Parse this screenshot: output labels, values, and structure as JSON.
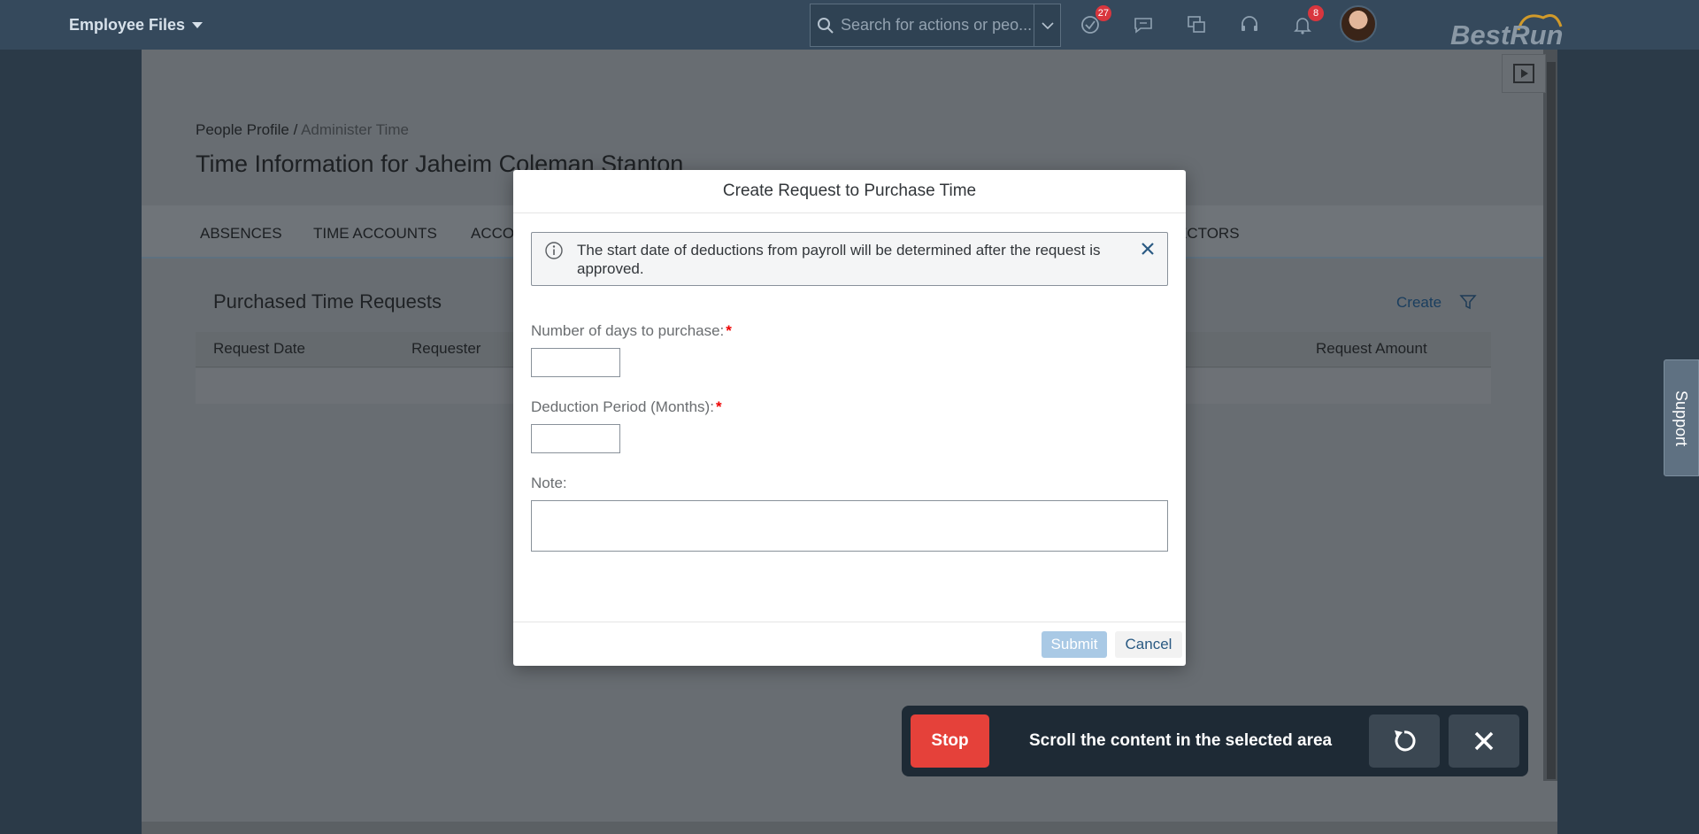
{
  "shell": {
    "module": "Employee Files",
    "search_placeholder": "Search for actions or peo...",
    "todo_count": "27",
    "notification_count": "8",
    "logo_text": "BestRun",
    "icons": [
      "search-icon",
      "todo-icon",
      "chat-icon",
      "people-chat-icon",
      "headset-icon",
      "bell-icon"
    ]
  },
  "page": {
    "breadcrumb_root": "People Profile",
    "breadcrumb_sep": " / ",
    "breadcrumb_current": "Administer Time",
    "title": "Time Information for Jaheim Coleman Stanton",
    "tabs": [
      "ABSENCES",
      "TIME ACCOUNTS",
      "ACCO",
      "ECTORS"
    ],
    "section_title": "Purchased Time Requests",
    "create_label": "Create",
    "columns": [
      "Request Date",
      "Requester",
      "Request Amount"
    ]
  },
  "support_label": "Support",
  "dialog": {
    "title": "Create Request to Purchase Time",
    "info_message": "The start date of deductions from payroll will be determined after the request is approved.",
    "fields": {
      "days_label": "Number of days to purchase:",
      "days_value": "",
      "period_label": "Deduction Period (Months):",
      "period_value": "",
      "note_label": "Note:",
      "note_value": "",
      "required_mark": "*"
    },
    "submit_label": "Submit",
    "cancel_label": "Cancel"
  },
  "automation": {
    "stop_label": "Stop",
    "instruction": "Scroll the content in the selected area"
  },
  "colors": {
    "shell": "#35495c",
    "accent_blue": "#0a6ed1",
    "stop_red": "#e5413a",
    "required_red": "#ee0000"
  }
}
